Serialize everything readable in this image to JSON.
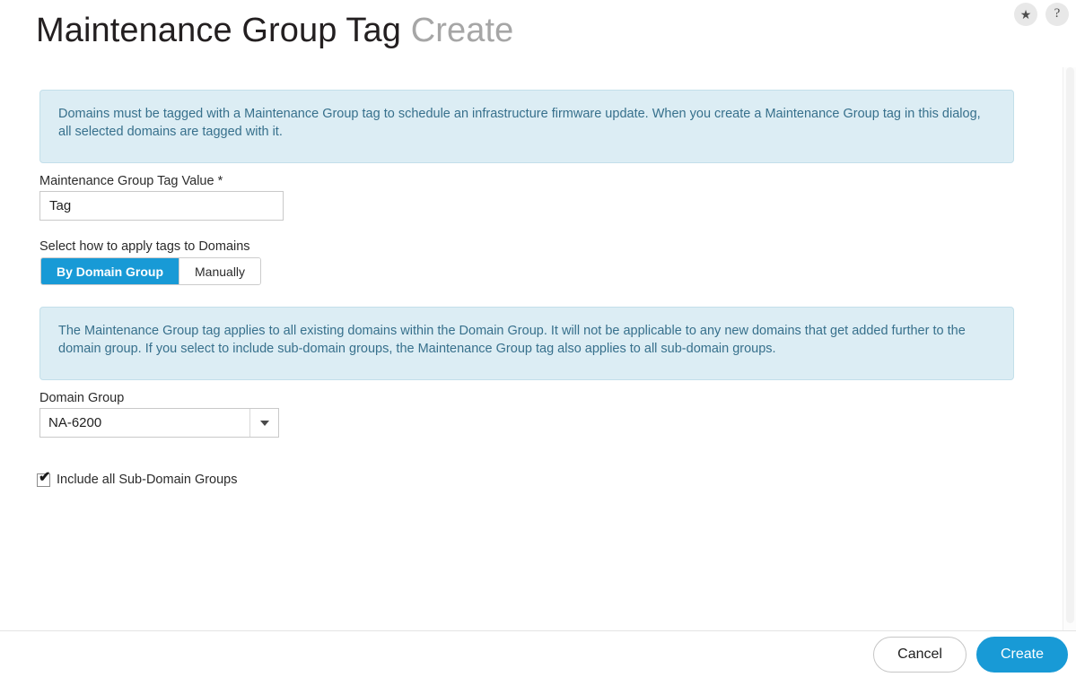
{
  "header": {
    "title_main": "Maintenance Group Tag",
    "title_sub": "Create",
    "favorite_icon": "star-icon",
    "help_icon": "question-mark-icon",
    "favorite_glyph": "★",
    "help_glyph": "?"
  },
  "banners": {
    "top": "Domains must be tagged with a Maintenance Group tag to schedule an infrastructure firmware update. When you create a Maintenance Group tag in this dialog, all selected domains are tagged with it.",
    "domain_group": "The Maintenance Group tag applies to all existing domains within the Domain Group. It will not be applicable to any new domains that get added further to the domain group. If you select to include sub-domain groups, the Maintenance Group tag also applies to all sub-domain groups."
  },
  "form": {
    "tag_value": {
      "label": "Maintenance Group Tag Value",
      "required_marker": "*",
      "value": "Tag",
      "placeholder": "Tag"
    },
    "apply_mode": {
      "label": "Select how to apply tags to Domains",
      "options": [
        "By Domain Group",
        "Manually"
      ],
      "selected": "By Domain Group"
    },
    "domain_group": {
      "label": "Domain Group",
      "selected": "NA-6200",
      "caret_icon": "chevron-down-icon"
    },
    "include_sub_domain_groups": {
      "label": "Include all Sub-Domain Groups",
      "checked": true,
      "check_glyph": "✔"
    }
  },
  "footer": {
    "cancel_label": "Cancel",
    "create_label": "Create"
  },
  "colors": {
    "accent_blue": "#189ad6",
    "banner_bg": "#dcedf4",
    "banner_border": "#c3dfea",
    "banner_text": "#37708c",
    "title_sub": "#a6a6a6"
  }
}
